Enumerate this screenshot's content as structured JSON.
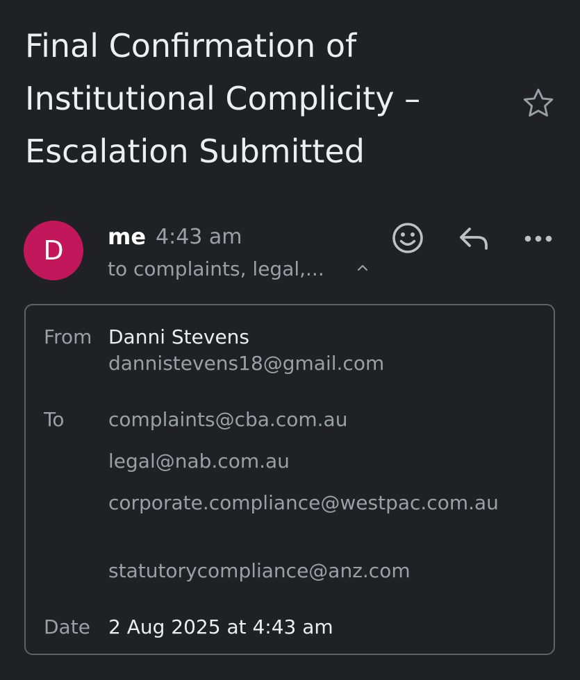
{
  "email": {
    "subject": "Final Confirmation of Institutional Complicity – Escalation Submitted",
    "sender_label": "me",
    "time": "4:43 am",
    "recipients_summary": "to complaints, legal,...",
    "avatar_initial": "D",
    "avatar_color": "#c2185b"
  },
  "details": {
    "from_label": "From",
    "from_name": "Danni Stevens",
    "from_email": "dannistevens18@gmail.com",
    "to_label": "To",
    "to": [
      "complaints@cba.com.au",
      "legal@nab.com.au",
      "corporate.compliance@westpac.com.au",
      "statutorycompliance@anz.com"
    ],
    "date_label": "Date",
    "date_value": "2 Aug 2025 at 4:43 am"
  },
  "icons": {
    "star": "star-outline-icon",
    "emoji": "emoji-reaction-icon",
    "reply": "reply-icon",
    "more": "more-horizontal-icon",
    "collapse": "chevron-up-icon"
  }
}
